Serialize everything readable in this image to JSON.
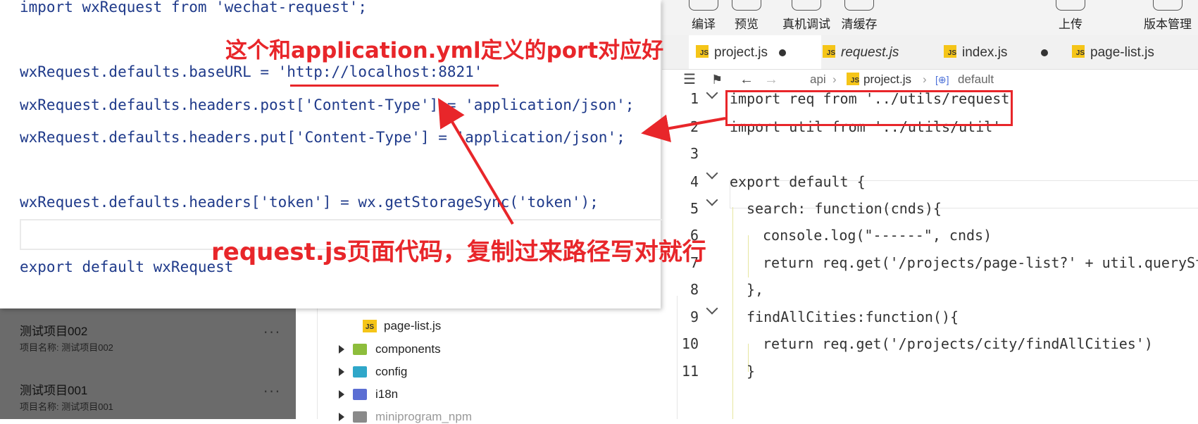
{
  "toolbar": {
    "compile": "编译",
    "preview": "预览",
    "device_debug": "真机调试",
    "clear_cache": "清缓存",
    "upload": "上传",
    "version": "版本管理"
  },
  "tabs": [
    {
      "label": "project.js",
      "modified": true,
      "active": true
    },
    {
      "label": "request.js",
      "italic": true
    },
    {
      "label": "index.js",
      "modified": true
    },
    {
      "label": "page-list.js"
    }
  ],
  "breadcrumb": {
    "api": "api",
    "file": "project.js",
    "symbol": "default"
  },
  "editor": {
    "line_numbers": [
      "1",
      "2",
      "3",
      "4",
      "5",
      "6",
      "7",
      "8",
      "9",
      "10",
      "11"
    ],
    "line1": "import req from '../utils/request",
    "line2": "import util from '../utils/util'",
    "line4": "export default {",
    "line5": "search: function(cnds){",
    "line6": "console.log(\"------\", cnds)",
    "line7": "return req.get('/projects/page-list?' + util.querySt",
    "line8": "},",
    "line9": "findAllCities:function(){",
    "line10": "return req.get('/projects/city/findAllCities')",
    "line11": "}"
  },
  "popup": {
    "l1": "import wxRequest from 'wechat-request';",
    "l2": "wxRequest.defaults.baseURL = 'http://localhost:8821'",
    "l3": "wxRequest.defaults.headers.post['Content-Type'] = 'application/json';",
    "l4": "wxRequest.defaults.headers.put['Content-Type'] = 'application/json';",
    "l5": "wxRequest.defaults.headers['token'] = wx.getStorageSync('token');",
    "l6": "export default wxRequest"
  },
  "annotations": {
    "top": "这个和application.yml定义的port对应好",
    "bottom": "request.js页面代码，复制过来路径写对就行"
  },
  "projects": [
    {
      "title": "测试项目002",
      "sub": "项目名称: 测试项目002"
    },
    {
      "title": "测试项目001",
      "sub": "项目名称: 测试项目001"
    }
  ],
  "tree": {
    "page_list": "page-list.js",
    "components": "components",
    "config": "config",
    "i18n": "i18n",
    "miniprogram_npm": "miniprogram_npm"
  },
  "colors": {
    "annotation": "#e8262a",
    "js_badge": "#f5c518",
    "list_bg": "#6b6b6b"
  }
}
